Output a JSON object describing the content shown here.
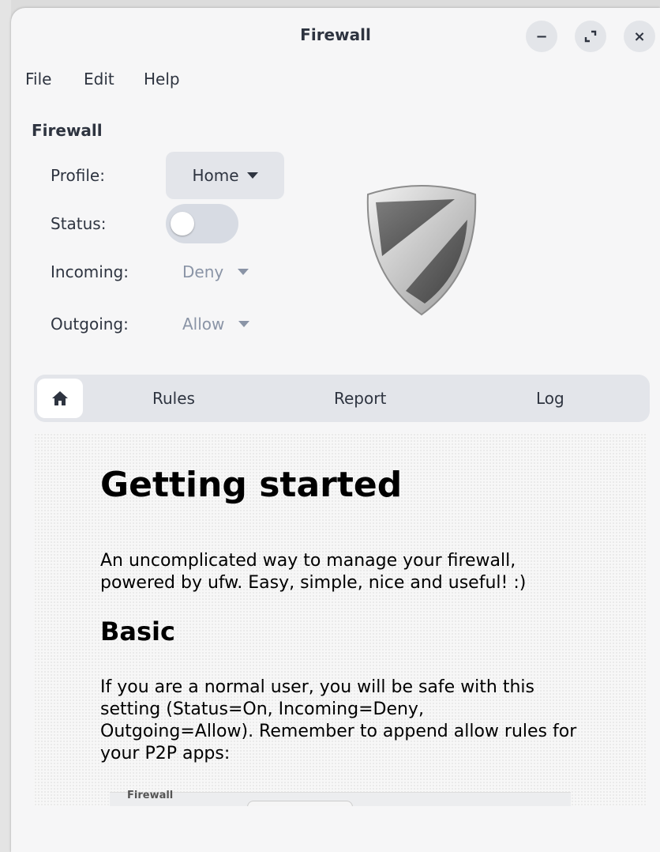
{
  "window": {
    "title": "Firewall",
    "controls": {
      "minimize": "−",
      "maximize": "⤢",
      "close": "×"
    }
  },
  "menu": [
    "File",
    "Edit",
    "Help"
  ],
  "section_title": "Firewall",
  "settings": {
    "profile_label": "Profile:",
    "profile_value": "Home",
    "status_label": "Status:",
    "status_on": false,
    "incoming_label": "Incoming:",
    "incoming_value": "Deny",
    "outgoing_label": "Outgoing:",
    "outgoing_value": "Allow"
  },
  "tabs": {
    "home_icon": "home-icon",
    "items": [
      "Rules",
      "Report",
      "Log"
    ]
  },
  "doc": {
    "heading": "Getting started",
    "intro": "An uncomplicated way to manage your firewall, powered by ufw. Easy, simple, nice and useful! :)",
    "basic_heading": "Basic",
    "basic_text": "If you are a normal user, you will be safe with this setting (Status=On, Incoming=Deny, Outgoing=Allow). Remember to append allow rules for your P2P apps:",
    "embedded_label": "Firewall"
  },
  "colors": {
    "accent": "#2e3440",
    "dim": "#8a94a6",
    "toggle_off": "#d7dbe3"
  }
}
